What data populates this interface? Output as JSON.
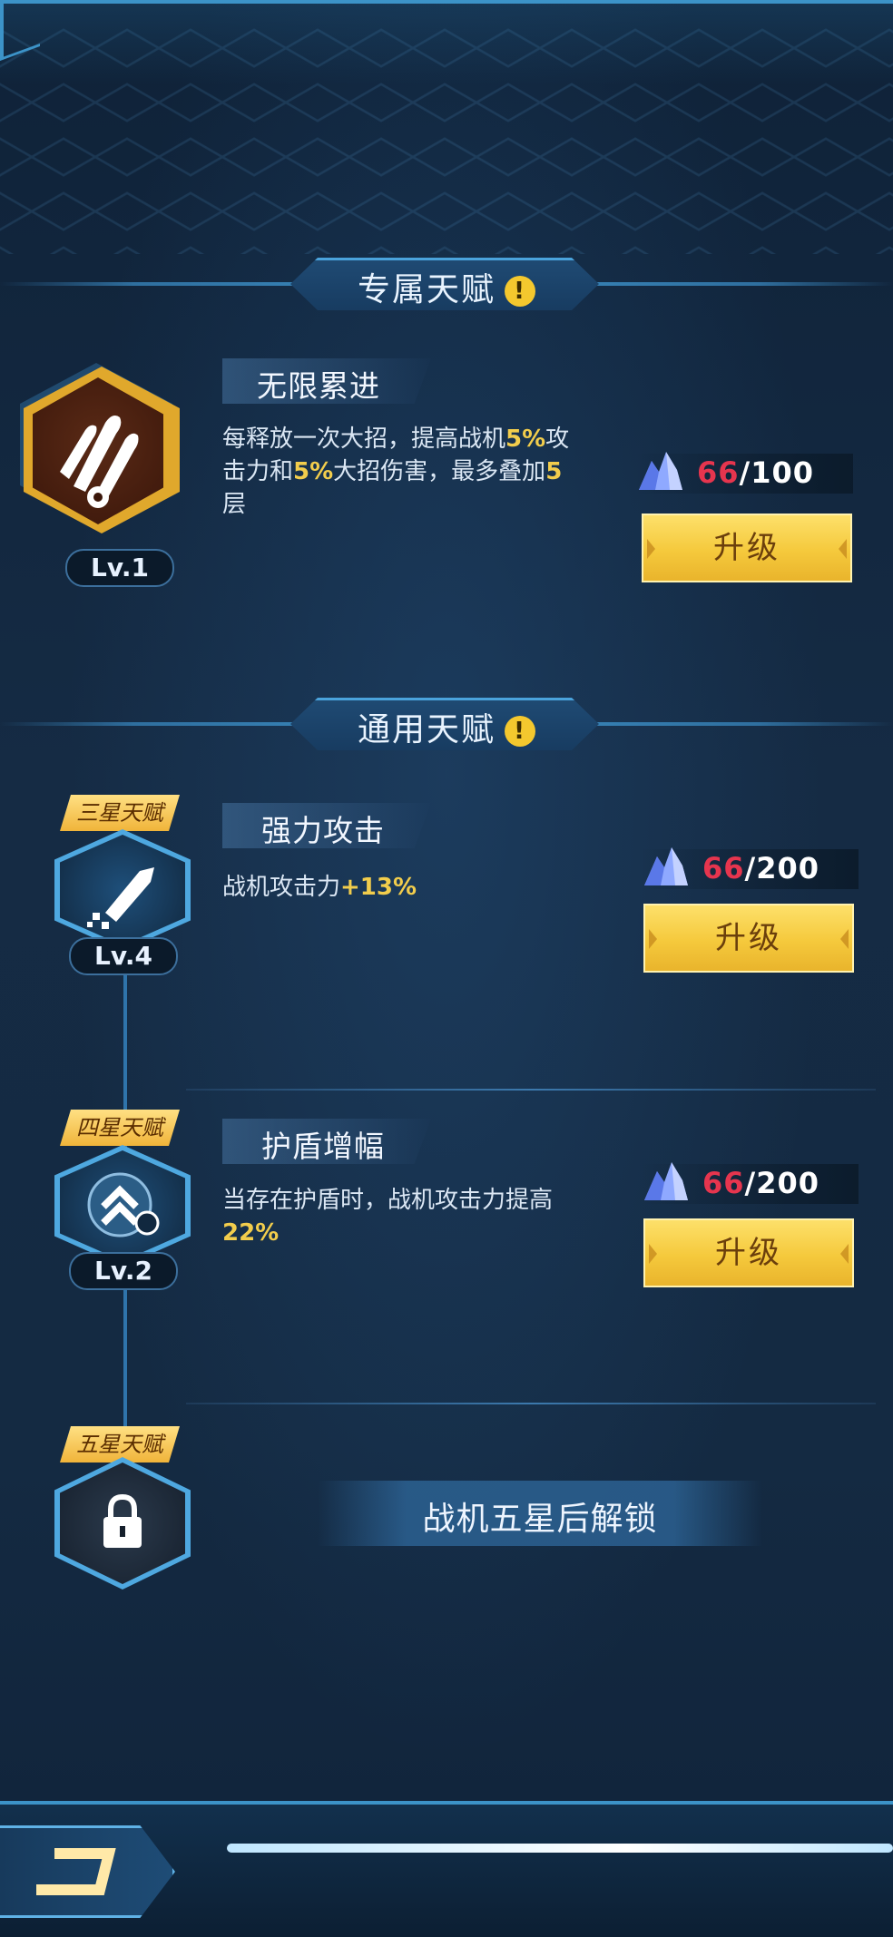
{
  "sections": {
    "exclusive": {
      "title": "专属天赋",
      "alert": "!"
    },
    "general": {
      "title": "通用天赋",
      "alert": "!"
    }
  },
  "exclusive_talent": {
    "icon": "missiles-icon",
    "level": "Lv.1",
    "name": "无限累进",
    "desc_parts": [
      "每释放一次大招，提高战机",
      "5%",
      "攻",
      "击力和",
      "5%",
      "大招伤害，最多叠加",
      "5",
      "层"
    ],
    "cost_have": "66",
    "cost_sep": "/",
    "cost_need": "100",
    "upgrade_label": "升级"
  },
  "general_talents": [
    {
      "tag": "三星天赋",
      "icon": "sword-icon",
      "level": "Lv.4",
      "name": "强力攻击",
      "desc_text": "战机攻击力",
      "desc_hl": "+13%",
      "cost_have": "66",
      "cost_sep": "/",
      "cost_need": "200",
      "upgrade_label": "升级"
    },
    {
      "tag": "四星天赋",
      "icon": "shield-boost-icon",
      "level": "Lv.2",
      "name": "护盾增幅",
      "desc_text": "当存在护盾时，战机攻击力提高",
      "desc_hl": "22%",
      "cost_have": "66",
      "cost_sep": "/",
      "cost_need": "200",
      "upgrade_label": "升级"
    },
    {
      "tag": "五星天赋",
      "icon": "lock-icon",
      "locked_text": "战机五星后解锁"
    }
  ],
  "colors": {
    "accent": "#3c93c8",
    "highlight": "#f2cd4c",
    "cost_have": "#e6354e",
    "button": "#f5c93c"
  }
}
